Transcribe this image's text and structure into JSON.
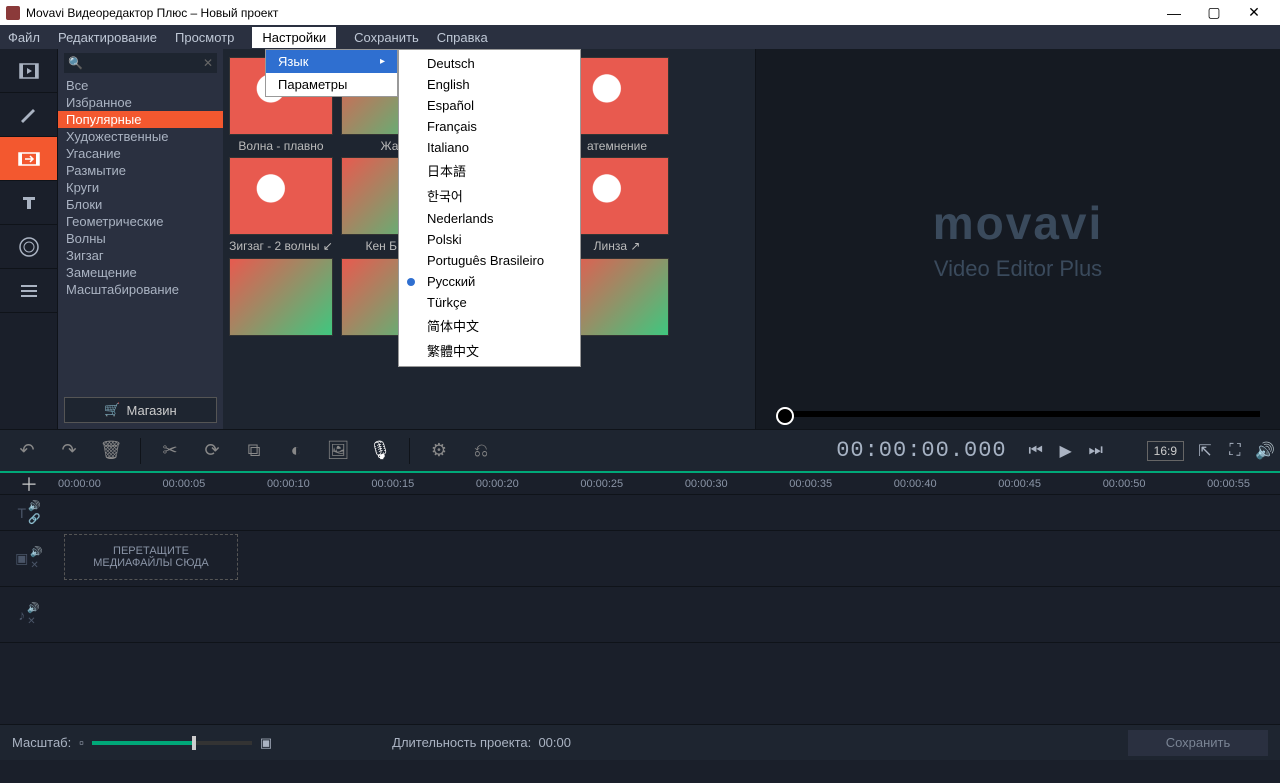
{
  "titlebar": {
    "title": "Movavi Видеоредактор Плюс – Новый проект"
  },
  "menubar": [
    "Файл",
    "Редактирование",
    "Просмотр",
    "Настройки",
    "Сохранить",
    "Справка"
  ],
  "settings_submenu": {
    "language": "Язык",
    "params": "Параметры"
  },
  "languages": [
    "Deutsch",
    "English",
    "Español",
    "Français",
    "Italiano",
    "日本語",
    "한국어",
    "Nederlands",
    "Polski",
    "Português Brasileiro",
    "Русский",
    "Türkçe",
    "简体中文",
    "繁體中文"
  ],
  "selected_language_index": 10,
  "categories": [
    "Все",
    "Избранное",
    "Популярные",
    "Художественные",
    "Угасание",
    "Размытие",
    "Круги",
    "Блоки",
    "Геометрические",
    "Волны",
    "Зигзаг",
    "Замещение",
    "Масштабирование"
  ],
  "selected_category_index": 2,
  "shop_label": "Магазин",
  "thumbs": [
    {
      "label": "Волна - плавно"
    },
    {
      "label": "Жал"
    },
    {
      "label": ""
    },
    {
      "label": "атемнение"
    },
    {
      "label": "Зигзаг - 2 волны ↙"
    },
    {
      "label": "Кен Б плa"
    },
    {
      "label": ""
    },
    {
      "label": "Линза ↗"
    }
  ],
  "preview": {
    "brand": "movavi",
    "sub": "Video Editor Plus"
  },
  "toolbar": {
    "timecode": "00:00:00.000",
    "ratio": "16:9"
  },
  "ruler_ticks": [
    "00:00:00",
    "00:00:05",
    "00:00:10",
    "00:00:15",
    "00:00:20",
    "00:00:25",
    "00:00:30",
    "00:00:35",
    "00:00:40",
    "00:00:45",
    "00:00:50",
    "00:00:55"
  ],
  "dropzone": {
    "line1": "ПЕРЕТАЩИТЕ",
    "line2": "МЕДИАФАЙЛЫ СЮДА"
  },
  "bottom": {
    "zoom_label": "Масштаб:",
    "duration_label": "Длительность проекта:",
    "duration_value": "00:00",
    "save": "Сохранить"
  }
}
